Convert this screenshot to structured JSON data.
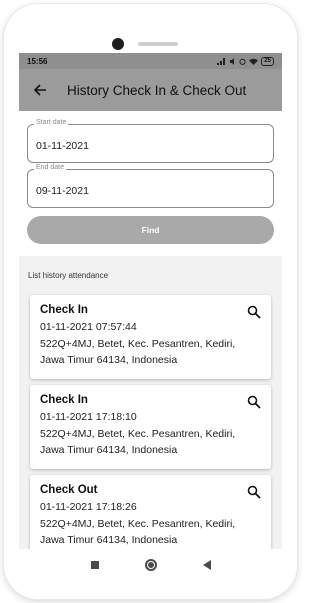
{
  "status_bar": {
    "time": "15:56",
    "icons": [
      "signal-icon",
      "mute-icon",
      "alarm-icon",
      "wifi-icon"
    ],
    "battery": "25"
  },
  "app_bar": {
    "title": "History Check In & Check Out"
  },
  "form": {
    "start_date": {
      "label": "Start date",
      "value": "01-11-2021"
    },
    "end_date": {
      "label": "End date",
      "value": "09-11-2021"
    },
    "find_label": "Find"
  },
  "list_label": "List history attendance",
  "records": [
    {
      "type": "Check In",
      "datetime": "01-11-2021 07:57:44",
      "address_line1": "522Q+4MJ, Betet, Kec. Pesantren, Kediri,",
      "address_line2": "Jawa Timur 64134, Indonesia"
    },
    {
      "type": "Check In",
      "datetime": "01-11-2021 17:18:10",
      "address_line1": "522Q+4MJ, Betet, Kec. Pesantren, Kediri,",
      "address_line2": "Jawa Timur 64134, Indonesia"
    },
    {
      "type": "Check Out",
      "datetime": "01-11-2021 17:18:26",
      "address_line1": "522Q+4MJ, Betet, Kec. Pesantren, Kediri,",
      "address_line2": "Jawa Timur 64134, Indonesia"
    }
  ]
}
